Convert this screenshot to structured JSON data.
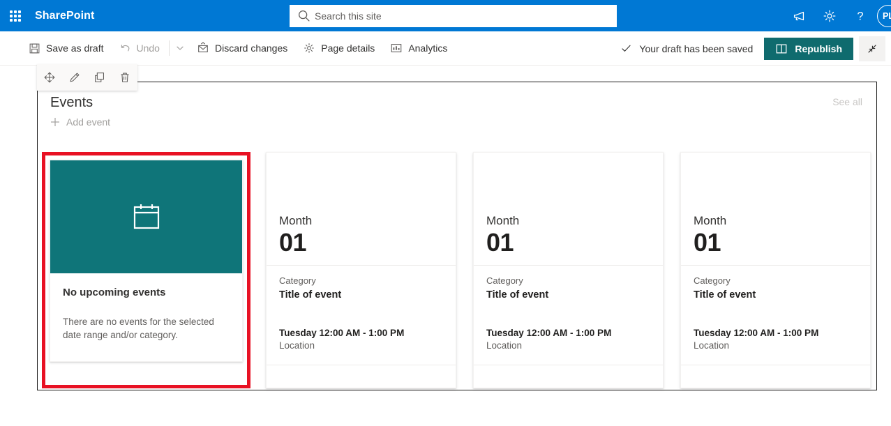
{
  "suite": {
    "waffle_label": "app-launcher",
    "brand": "SharePoint",
    "search_placeholder": "Search this site",
    "search_value": "",
    "icons": [
      {
        "name": "feedback-icon",
        "label": "Feedback"
      },
      {
        "name": "settings-icon",
        "label": "Settings"
      },
      {
        "name": "help-icon",
        "label": "Help"
      }
    ],
    "avatar_initials": "PL"
  },
  "command_bar": {
    "save_as_draft": "Save as draft",
    "undo": "Undo",
    "undo_disabled": true,
    "discard_changes": "Discard changes",
    "page_details": "Page details",
    "analytics": "Analytics",
    "save_status": "Your draft has been saved",
    "republish": "Republish",
    "collapse_label": "Exit full screen"
  },
  "left_rail": [
    {
      "name": "rail-edit-web-part",
      "label": "Edit web part"
    },
    {
      "name": "rail-move-web-part",
      "label": "Move web part"
    },
    {
      "name": "rail-duplicate-web-part",
      "label": "Duplicate web part"
    },
    {
      "name": "rail-delete-web-part",
      "label": "Delete web part"
    }
  ],
  "web_part_toolbar": [
    {
      "name": "move-handle-icon",
      "label": "Move"
    },
    {
      "name": "edit-pencil-icon",
      "label": "Edit web part"
    },
    {
      "name": "duplicate-icon",
      "label": "Duplicate"
    },
    {
      "name": "delete-icon",
      "label": "Delete"
    }
  ],
  "events_web_part": {
    "title": "Events",
    "add_event": "Add event",
    "see_all": "See all",
    "accent_color": "#0f7579",
    "selection_color": "#e81123",
    "empty_card": {
      "thumbnail_icon": "calendar-icon",
      "title": "No upcoming events",
      "description": "There are no events for the selected date range and/or category."
    },
    "placeholder_cards": [
      {
        "month": "Month",
        "day": "01",
        "category": "Category",
        "event_title": "Title of event",
        "when": "Tuesday 12:00 AM - 1:00 PM",
        "location": "Location"
      },
      {
        "month": "Month",
        "day": "01",
        "category": "Category",
        "event_title": "Title of event",
        "when": "Tuesday 12:00 AM - 1:00 PM",
        "location": "Location"
      },
      {
        "month": "Month",
        "day": "01",
        "category": "Category",
        "event_title": "Title of event",
        "when": "Tuesday 12:00 AM - 1:00 PM",
        "location": "Location"
      }
    ]
  }
}
